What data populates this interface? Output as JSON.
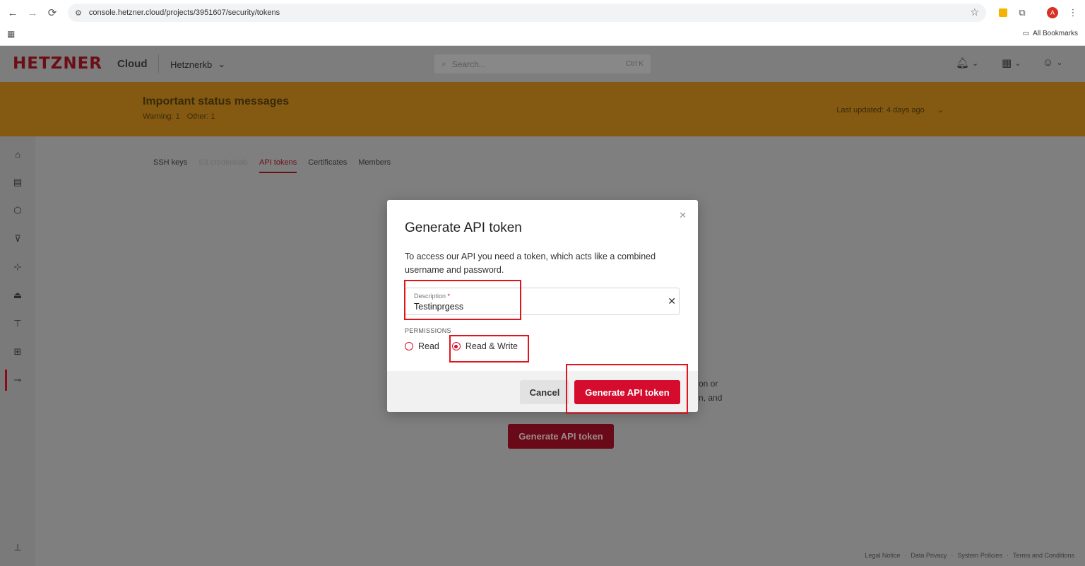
{
  "browser": {
    "url": "console.hetzner.cloud/projects/3951607/security/tokens",
    "all_bookmarks": "All Bookmarks",
    "profile_initial": "A"
  },
  "header": {
    "logo": "HETZNER",
    "product": "Cloud",
    "project": "Hetznerkb",
    "search_placeholder": "Search...",
    "search_shortcut": "Ctrl K"
  },
  "banner": {
    "title": "Important status messages",
    "warning": "Warning: 1",
    "other": "Other: 1",
    "updated_label": "Last updated:",
    "updated_value": "4 days ago"
  },
  "tabs": [
    {
      "label": "SSH keys"
    },
    {
      "label": "S3 credentials"
    },
    {
      "label": "API tokens"
    },
    {
      "label": "Certificates"
    },
    {
      "label": "Members"
    }
  ],
  "behind": {
    "text_right_1": "on or",
    "text_right_2": "n, and",
    "generate_button": "Generate API token"
  },
  "modal": {
    "title": "Generate API token",
    "description": "To access our API you need a token, which acts like a combined username and password.",
    "description_label": "Description",
    "description_required": "*",
    "description_value": "Testinprgess",
    "permissions_label": "PERMISSIONS",
    "option_read": "Read",
    "option_read_write": "Read & Write",
    "selected_permission": "Read & Write",
    "cancel": "Cancel",
    "generate": "Generate API token"
  },
  "footer": {
    "links": [
      "Legal Notice",
      "Data Privacy",
      "System Policies",
      "Terms and Conditions"
    ]
  },
  "colors": {
    "brand_red": "#d50c2d",
    "banner": "#845a12",
    "annotation": "#e3131e"
  }
}
